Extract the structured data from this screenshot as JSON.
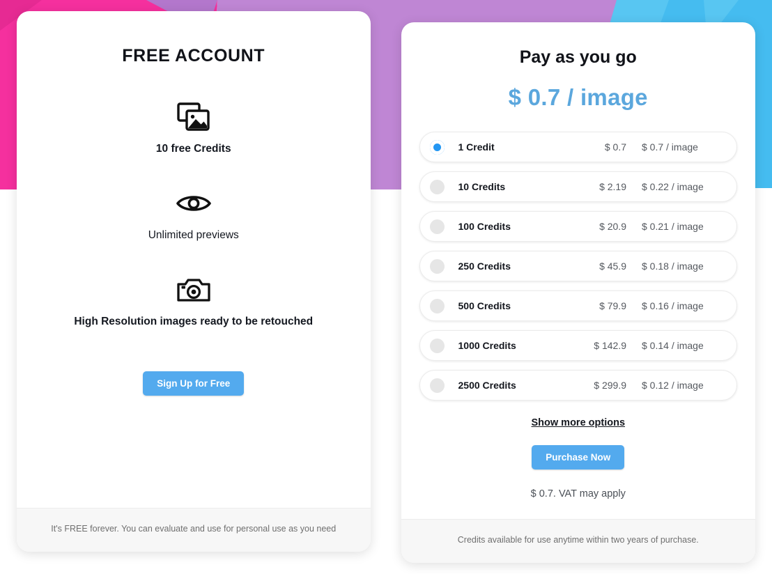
{
  "background": {
    "pink": "#f5309e",
    "pink_dark": "#e62a93",
    "purple": "#bf86d4",
    "purple_dark": "#b377cc",
    "cyan": "#45bcf0",
    "cyan_light": "#58c6f2",
    "white": "#ffffff"
  },
  "theme": {
    "accent_blue": "#53aaee",
    "price_blue": "#5ba7dd",
    "radio_blue": "#2196f3",
    "text_dark": "#13161d",
    "text_muted": "#6f6f6f",
    "footer_bg": "#f7f7f7"
  },
  "free_card": {
    "title": "FREE ACCOUNT",
    "features": [
      {
        "icon": "images-stack-icon",
        "label": "10 free Credits",
        "bold": true
      },
      {
        "icon": "eye-icon",
        "label": "Unlimited previews",
        "bold": false
      },
      {
        "icon": "camera-icon",
        "label": "High Resolution images ready to be retouched",
        "bold": true
      }
    ],
    "cta_label": "Sign Up for Free",
    "footer_note": "It's FREE forever. You can evaluate and use for personal use as you need"
  },
  "payg_card": {
    "title": "Pay as you go",
    "unit_price_headline": "$ 0.7 / image",
    "plans": [
      {
        "credits": "1 Credit",
        "price": "$ 0.7",
        "unit": "$ 0.7 / image",
        "selected": true
      },
      {
        "credits": "10 Credits",
        "price": "$ 2.19",
        "unit": "$ 0.22 / image",
        "selected": false
      },
      {
        "credits": "100 Credits",
        "price": "$ 20.9",
        "unit": "$ 0.21 / image",
        "selected": false
      },
      {
        "credits": "250 Credits",
        "price": "$ 45.9",
        "unit": "$ 0.18 / image",
        "selected": false
      },
      {
        "credits": "500 Credits",
        "price": "$ 79.9",
        "unit": "$ 0.16 / image",
        "selected": false
      },
      {
        "credits": "1000 Credits",
        "price": "$ 142.9",
        "unit": "$ 0.14 / image",
        "selected": false
      },
      {
        "credits": "2500 Credits",
        "price": "$ 299.9",
        "unit": "$ 0.12 / image",
        "selected": false
      }
    ],
    "show_more_label": "Show more options",
    "cta_label": "Purchase Now",
    "vat_note": "$ 0.7. VAT may apply",
    "footer_note": "Credits available for use anytime within two years of purchase."
  }
}
